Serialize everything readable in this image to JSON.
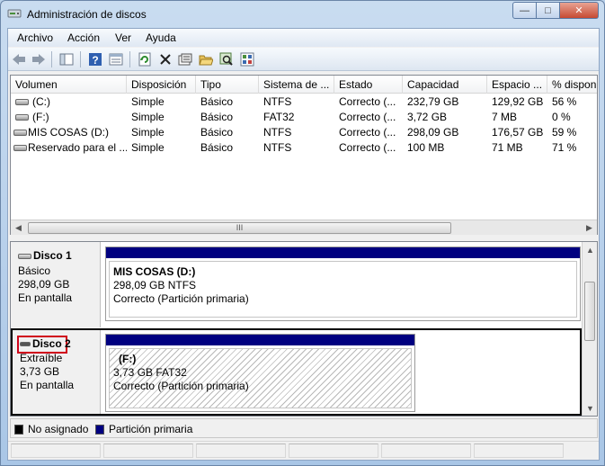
{
  "window": {
    "title": "Administración de discos",
    "controls": [
      "minimize",
      "maximize",
      "close"
    ]
  },
  "menu": [
    "Archivo",
    "Acción",
    "Ver",
    "Ayuda"
  ],
  "toolbar": {
    "icons": [
      "back-arrow-icon",
      "forward-arrow-icon",
      "show-hide-tree-icon",
      "help-icon",
      "properties-pane-icon",
      "refresh-icon",
      "delete-icon",
      "properties-icon",
      "open-folder-icon",
      "explore-icon",
      "settings-icon"
    ]
  },
  "volume_list": {
    "columns": [
      "Volumen",
      "Disposición",
      "Tipo",
      "Sistema de ...",
      "Estado",
      "Capacidad",
      "Espacio ...",
      "% dispon"
    ],
    "rows": [
      [
        "(C:)",
        "Simple",
        "Básico",
        "NTFS",
        "Correcto (...",
        "232,79 GB",
        "129,92 GB",
        "56 %"
      ],
      [
        "(F:)",
        "Simple",
        "Básico",
        "FAT32",
        "Correcto (...",
        "3,72 GB",
        "7 MB",
        "0 %"
      ],
      [
        "MIS COSAS (D:)",
        "Simple",
        "Básico",
        "NTFS",
        "Correcto (...",
        "298,09 GB",
        "176,57 GB",
        "59 %"
      ],
      [
        "Reservado para el ...",
        "Simple",
        "Básico",
        "NTFS",
        "Correcto (...",
        "100 MB",
        "71 MB",
        "71 %"
      ]
    ],
    "scroll_thumb_label": "III"
  },
  "disks": [
    {
      "name": "Disco 1",
      "type": "Básico",
      "size": "298,09 GB",
      "status": "En pantalla",
      "partition": {
        "label": "MIS COSAS  (D:)",
        "size_fs": "298,09 GB NTFS",
        "state": "Correcto (Partición primaria)"
      }
    },
    {
      "name": "Disco 2",
      "type": "Extraíble",
      "size": "3,73 GB",
      "status": "En pantalla",
      "partition": {
        "label": "(F:)",
        "size_fs": "3,73 GB FAT32",
        "state": "Correcto (Partición primaria)"
      }
    }
  ],
  "legend": {
    "items": [
      {
        "label": "No asignado",
        "color": "#000000"
      },
      {
        "label": "Partición primaria",
        "color": "#000080"
      }
    ]
  },
  "colors": {
    "partition_bar": "#000080",
    "highlight_red": "#d0021b"
  }
}
